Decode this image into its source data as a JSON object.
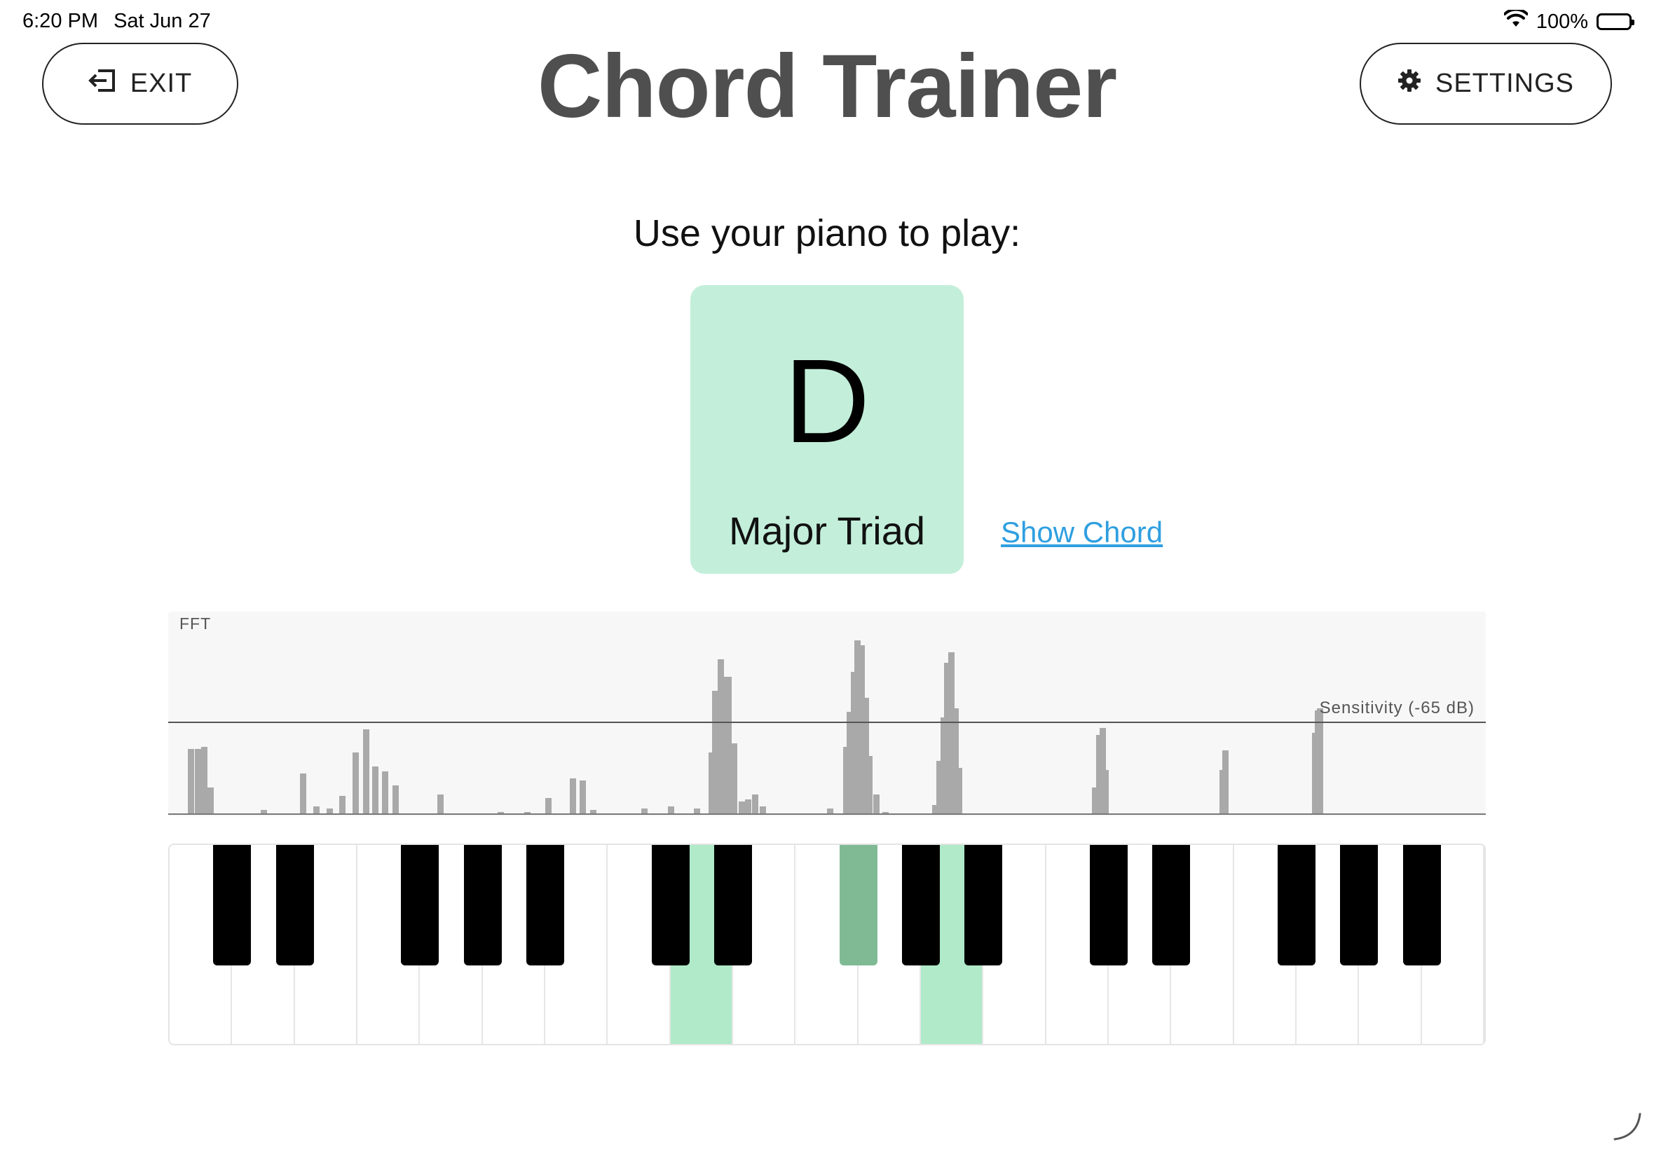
{
  "status_bar": {
    "time": "6:20 PM",
    "date": "Sat Jun 27",
    "battery": "100%"
  },
  "header": {
    "exit_label": "EXIT",
    "title": "Chord Trainer",
    "settings_label": "SETTINGS"
  },
  "prompt": "Use your piano to play:",
  "chord": {
    "root": "D",
    "quality": "Major Triad",
    "card_color": "#c3efda"
  },
  "show_chord_label": "Show Chord",
  "fft": {
    "label": "FFT",
    "sensitivity_label": "Sensitivity (-65 dB)",
    "bar_color": "#a9a9a9",
    "bars": [
      {
        "x": 1.5,
        "v": 0.37
      },
      {
        "x": 2.0,
        "v": 0.37
      },
      {
        "x": 2.5,
        "v": 0.38
      },
      {
        "x": 3.0,
        "v": 0.15
      },
      {
        "x": 7.0,
        "v": 0.02
      },
      {
        "x": 10.0,
        "v": 0.23
      },
      {
        "x": 11.0,
        "v": 0.04
      },
      {
        "x": 12.0,
        "v": 0.03
      },
      {
        "x": 13.0,
        "v": 0.1
      },
      {
        "x": 14.0,
        "v": 0.35
      },
      {
        "x": 14.8,
        "v": 0.48
      },
      {
        "x": 15.5,
        "v": 0.27
      },
      {
        "x": 16.2,
        "v": 0.24
      },
      {
        "x": 17.0,
        "v": 0.16
      },
      {
        "x": 20.4,
        "v": 0.11
      },
      {
        "x": 25.0,
        "v": 0.01
      },
      {
        "x": 27.0,
        "v": 0.01
      },
      {
        "x": 28.6,
        "v": 0.09
      },
      {
        "x": 30.5,
        "v": 0.2
      },
      {
        "x": 31.2,
        "v": 0.19
      },
      {
        "x": 32.0,
        "v": 0.02
      },
      {
        "x": 35.9,
        "v": 0.03
      },
      {
        "x": 37.9,
        "v": 0.04
      },
      {
        "x": 39.9,
        "v": 0.03
      },
      {
        "x": 41.0,
        "v": 0.35
      },
      {
        "x": 41.3,
        "v": 0.7
      },
      {
        "x": 41.7,
        "v": 0.88
      },
      {
        "x": 42.0,
        "v": 0.78
      },
      {
        "x": 42.3,
        "v": 0.78
      },
      {
        "x": 42.7,
        "v": 0.4
      },
      {
        "x": 43.3,
        "v": 0.07
      },
      {
        "x": 43.8,
        "v": 0.08
      },
      {
        "x": 44.3,
        "v": 0.11
      },
      {
        "x": 44.9,
        "v": 0.04
      },
      {
        "x": 50.0,
        "v": 0.03
      },
      {
        "x": 51.2,
        "v": 0.38
      },
      {
        "x": 51.5,
        "v": 0.58
      },
      {
        "x": 51.8,
        "v": 0.81
      },
      {
        "x": 52.1,
        "v": 0.99
      },
      {
        "x": 52.4,
        "v": 0.96
      },
      {
        "x": 52.7,
        "v": 0.66
      },
      {
        "x": 53.0,
        "v": 0.33
      },
      {
        "x": 53.5,
        "v": 0.11
      },
      {
        "x": 54.2,
        "v": 0.01
      },
      {
        "x": 58.0,
        "v": 0.05
      },
      {
        "x": 58.3,
        "v": 0.3
      },
      {
        "x": 58.6,
        "v": 0.55
      },
      {
        "x": 58.9,
        "v": 0.86
      },
      {
        "x": 59.2,
        "v": 0.92
      },
      {
        "x": 59.5,
        "v": 0.6
      },
      {
        "x": 59.8,
        "v": 0.26
      },
      {
        "x": 70.1,
        "v": 0.15
      },
      {
        "x": 70.4,
        "v": 0.45
      },
      {
        "x": 70.7,
        "v": 0.49
      },
      {
        "x": 70.9,
        "v": 0.25
      },
      {
        "x": 79.8,
        "v": 0.25
      },
      {
        "x": 80.0,
        "v": 0.36
      },
      {
        "x": 86.8,
        "v": 0.46
      },
      {
        "x": 87.0,
        "v": 0.59
      },
      {
        "x": 87.2,
        "v": 0.6
      }
    ]
  },
  "keyboard": {
    "white_key_count": 21,
    "highlight_color": "#b0eac9",
    "active_black_color": "#7fba95",
    "active_white_keys": [
      8,
      12
    ],
    "black_keys": [
      {
        "after_white": 0,
        "active": false
      },
      {
        "after_white": 1,
        "active": false
      },
      {
        "after_white": 3,
        "active": false
      },
      {
        "after_white": 4,
        "active": false
      },
      {
        "after_white": 5,
        "active": false
      },
      {
        "after_white": 7,
        "active": false
      },
      {
        "after_white": 8,
        "active": false
      },
      {
        "after_white": 10,
        "active": true
      },
      {
        "after_white": 11,
        "active": false
      },
      {
        "after_white": 12,
        "active": false
      },
      {
        "after_white": 14,
        "active": false
      },
      {
        "after_white": 15,
        "active": false
      },
      {
        "after_white": 17,
        "active": false
      },
      {
        "after_white": 18,
        "active": false
      },
      {
        "after_white": 19,
        "active": false
      }
    ]
  }
}
